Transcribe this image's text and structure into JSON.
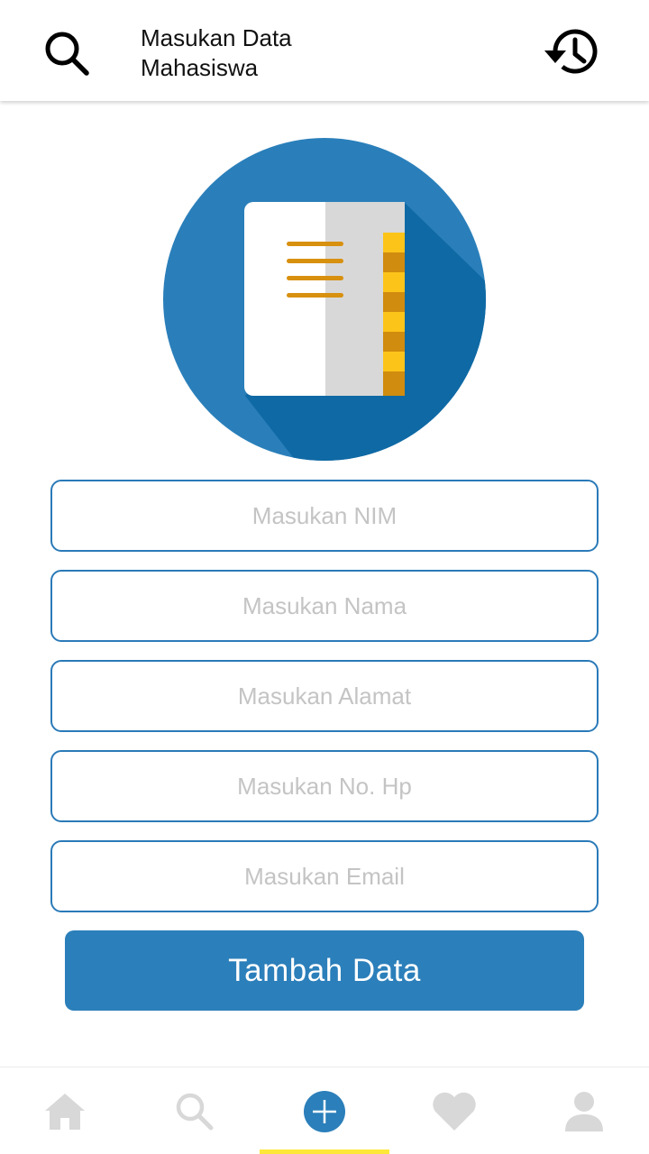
{
  "app_bar": {
    "title_line1": "Masukan Data",
    "title_line2": "Mahasiswa",
    "search_icon": "search-icon",
    "history_icon": "history-icon"
  },
  "illustration": {
    "icon": "notebook-icon",
    "circle_color": "#2a7fba",
    "shadow_color": "#0f69a4"
  },
  "form": {
    "fields": [
      {
        "name": "nim",
        "value": "",
        "placeholder": "Masukan NIM"
      },
      {
        "name": "nama",
        "value": "",
        "placeholder": "Masukan Nama"
      },
      {
        "name": "alamat",
        "value": "",
        "placeholder": "Masukan Alamat"
      },
      {
        "name": "no_hp",
        "value": "",
        "placeholder": "Masukan No. Hp"
      },
      {
        "name": "email",
        "value": "",
        "placeholder": "Masukan Email"
      }
    ],
    "submit_label": "Tambah Data"
  },
  "bottom_nav": {
    "items": [
      {
        "icon": "home-icon",
        "active": false
      },
      {
        "icon": "search-icon",
        "active": false
      },
      {
        "icon": "add-circle-icon",
        "active": true
      },
      {
        "icon": "heart-icon",
        "active": false
      },
      {
        "icon": "person-icon",
        "active": false
      }
    ],
    "active_color": "#2b7fba",
    "inactive_color": "#d8d8d8",
    "indicator_color": "#fde83a"
  },
  "colors": {
    "accent": "#2b7fba",
    "field_border": "#2a7ab8",
    "placeholder": "#c4c4c4"
  }
}
